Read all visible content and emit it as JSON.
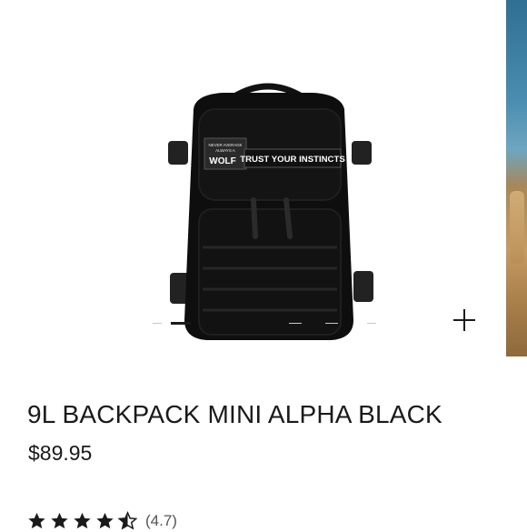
{
  "product": {
    "title": "9L BACKPACK MINI ALPHA BLACK",
    "price": "$89.95",
    "rating_value": 4.5,
    "rating_text": "(4.7)",
    "image_alt": "black tactical backpack",
    "patch": {
      "small_lines": [
        "NEVER AVERAGE",
        "ALWAYS A"
      ],
      "brand": "WOLF",
      "slogan": "TRUST YOUR INSTINCTS"
    }
  },
  "gallery": {
    "image_count": 5,
    "active_index": 1,
    "zoom_icon": "plus-icon"
  },
  "colors": {
    "text": "#1a1a1a",
    "star": "#1a1a1a",
    "pager_active": "#1a1a1a",
    "pager_inactive": "#c8c8c8"
  }
}
